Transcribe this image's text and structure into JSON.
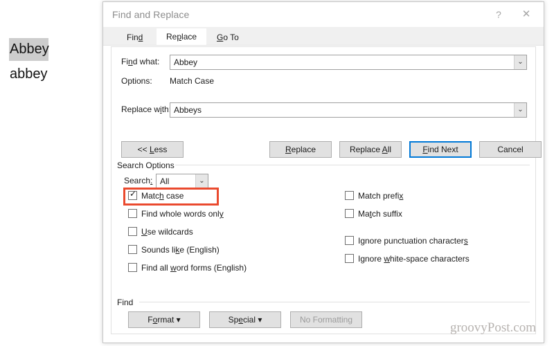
{
  "document": {
    "selected_word": "Abbey",
    "plain_word": "abbey"
  },
  "dialog": {
    "title": "Find and Replace",
    "help_icon": "?",
    "close_icon": "✕"
  },
  "tabs": [
    {
      "name": "find",
      "label": "Find",
      "accel_pre": "Fin",
      "accel": "d",
      "accel_post": ""
    },
    {
      "name": "replace",
      "label": "Replace",
      "accel_pre": "Re",
      "accel": "p",
      "accel_post": "lace"
    },
    {
      "name": "goto",
      "label": "Go To",
      "accel_pre": "",
      "accel": "G",
      "accel_post": "o To"
    }
  ],
  "active_tab": "replace",
  "fields": {
    "find_what": {
      "label_pre": "Fi",
      "label_accel": "n",
      "label_post": "d what:",
      "value": "Abbey",
      "arrow_icon": "⌄"
    },
    "options": {
      "label": "Options:",
      "value": "Match Case"
    },
    "replace_with": {
      "label_pre": "Replace w",
      "label_accel": "i",
      "label_post": "th:",
      "value": "Abbeys",
      "arrow_icon": "⌄"
    }
  },
  "buttons": {
    "less": {
      "pre": "<< ",
      "accel": "L",
      "post": "ess"
    },
    "replace": {
      "pre": "",
      "accel": "R",
      "post": "eplace"
    },
    "replace_all": {
      "pre": "Replace ",
      "accel": "A",
      "post": "ll"
    },
    "find_next": {
      "pre": "",
      "accel": "F",
      "post": "ind Next"
    },
    "cancel": {
      "pre": "Cancel",
      "accel": "",
      "post": ""
    }
  },
  "search_options": {
    "group_label": "Search Options",
    "search_label_pre": "Search",
    "search_label_accel": ":",
    "search_label_post": "",
    "search_value": "All",
    "search_arrow_icon": "⌄",
    "left_checkboxes": [
      {
        "name": "match-case",
        "pre": "Matc",
        "accel": "h",
        "post": " case",
        "checked": true,
        "highlighted": true
      },
      {
        "name": "whole-words",
        "pre": "Find whole words onl",
        "accel": "y",
        "post": "",
        "checked": false,
        "highlighted": false
      },
      {
        "name": "use-wildcards",
        "pre": "",
        "accel": "U",
        "post": "se wildcards",
        "checked": false,
        "highlighted": false
      },
      {
        "name": "sounds-like",
        "pre": "Sounds li",
        "accel": "k",
        "post": "e (English)",
        "checked": false,
        "highlighted": false
      },
      {
        "name": "all-word-forms",
        "pre": "Find all ",
        "accel": "w",
        "post": "ord forms (English)",
        "checked": false,
        "highlighted": false
      }
    ],
    "right_checkboxes": [
      {
        "name": "match-prefix",
        "pre": "Match prefi",
        "accel": "x",
        "post": "",
        "checked": false
      },
      {
        "name": "match-suffix",
        "pre": "Ma",
        "accel": "t",
        "post": "ch suffix",
        "checked": false
      },
      {
        "name": "ignore-punctuation",
        "pre": "Ignore punctuation character",
        "accel": "s",
        "post": "",
        "checked": false
      },
      {
        "name": "ignore-whitespace",
        "pre": "Ignore ",
        "accel": "w",
        "post": "hite-space characters",
        "checked": false
      }
    ],
    "checkmark_glyph": "✓"
  },
  "find_section": {
    "group_label": "Find",
    "format_button": {
      "pre": "F",
      "accel": "o",
      "post": "rmat",
      "caret": "▾"
    },
    "special_button": {
      "pre": "Sp",
      "accel": "e",
      "post": "cial",
      "caret": "▾"
    },
    "no_formatting_button": {
      "label": "No Formatting",
      "disabled": true
    }
  },
  "watermark": "groovyPost.com",
  "colors": {
    "focus_blue": "#0078d7",
    "annotation_red": "#ea4a2e",
    "selection_grey": "#cdcdcd",
    "button_face": "#e1e1e1"
  }
}
